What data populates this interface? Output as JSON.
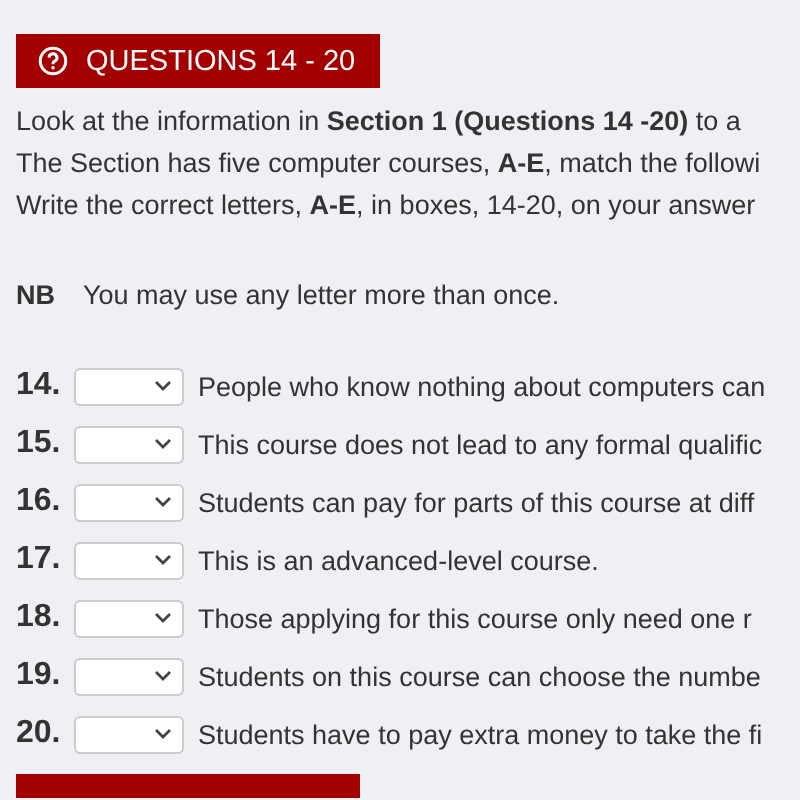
{
  "header": {
    "title": "QUESTIONS 14 - 20"
  },
  "instructions": [
    "Look at the information in **Section 1 (Questions 14 -20)** to a",
    "The Section has five computer courses, **A-E**, match the followi",
    "Write the correct letters, **A-E**, in boxes, 14-20, on your answer"
  ],
  "note": {
    "label": "NB",
    "text": "You may use any letter more than once."
  },
  "questions": [
    {
      "number": "14.",
      "text": "People who know nothing about computers can"
    },
    {
      "number": "15.",
      "text": "This course does not lead to any formal qualific"
    },
    {
      "number": "16.",
      "text": "Students can pay for parts of this course at diff"
    },
    {
      "number": "17.",
      "text": "This is an advanced-level course."
    },
    {
      "number": "18.",
      "text": "Those applying for this course only need one r"
    },
    {
      "number": "19.",
      "text": "Students on this course can choose the numbe"
    },
    {
      "number": "20.",
      "text": "Students have to pay extra money to take the fi"
    }
  ]
}
